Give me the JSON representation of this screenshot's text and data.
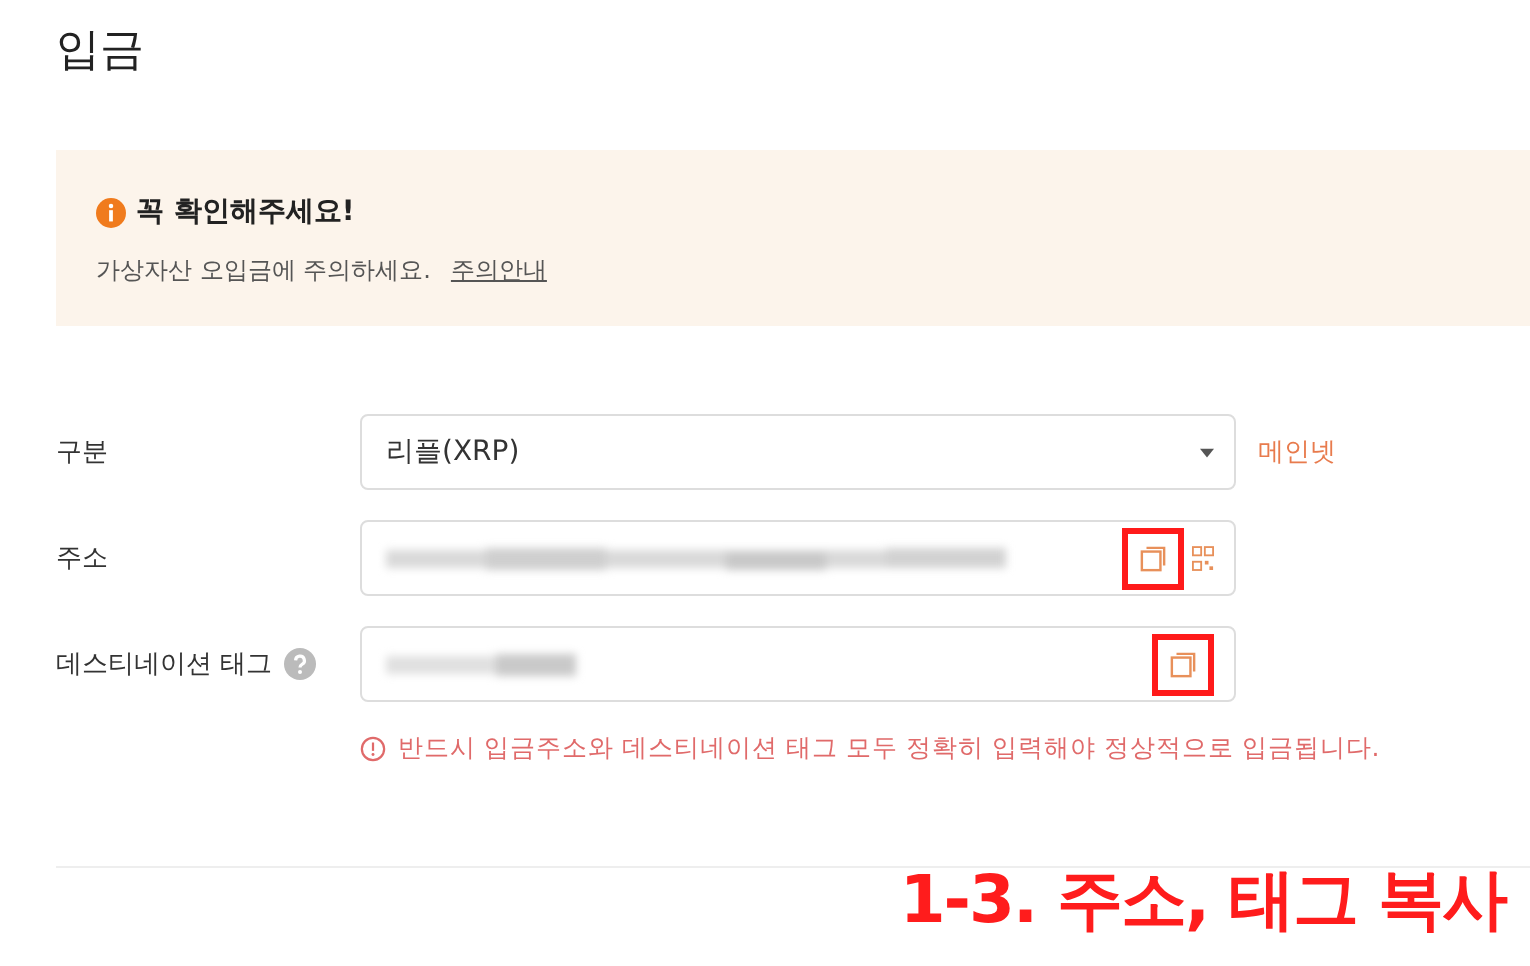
{
  "page_title": "입금",
  "notice": {
    "title": "꼭 확인해주세요!",
    "text": "가상자산 오입금에 주의하세요.",
    "link": "주의안내"
  },
  "form": {
    "rows": [
      {
        "kind": "select",
        "label": "구분",
        "value": "리플(XRP)",
        "side_text": "메인넷"
      },
      {
        "kind": "address",
        "label": "주소",
        "redacted": true,
        "copy_highlighted": true,
        "qr": true
      },
      {
        "kind": "tag",
        "label": "데스티네이션 태그",
        "help": true,
        "redacted": true,
        "copy_highlighted": true
      }
    ],
    "warning": "반드시 입금주소와 데스티네이션 태그 모두 정확히 입력해야 정상적으로 입금됩니다."
  },
  "caption": "1-3. 주소, 태그 복사"
}
